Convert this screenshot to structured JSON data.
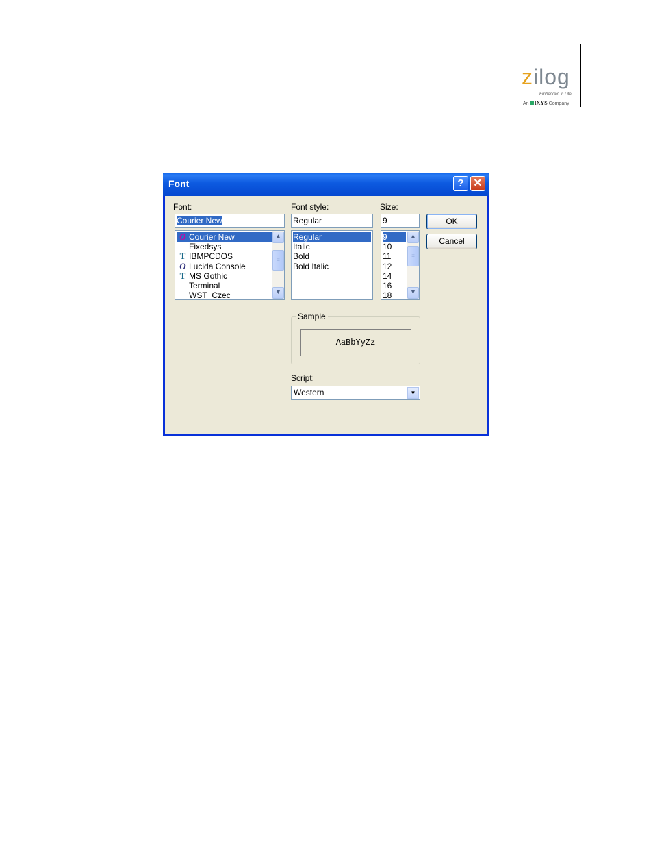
{
  "logo": {
    "wordmark_z": "z",
    "wordmark_rest": "ilog",
    "tagline": "Embedded in Life",
    "company_prefix": "An",
    "company_name": "IXYS",
    "company_suffix": "Company"
  },
  "dialog": {
    "title": "Font",
    "help_button": "?",
    "close_button": "✕",
    "font": {
      "label": "Font:",
      "value": "Courier New",
      "items": [
        {
          "icon": "O",
          "type": "opentype",
          "label": "Courier New",
          "selected": true
        },
        {
          "icon": "",
          "type": "none",
          "label": "Fixedsys"
        },
        {
          "icon": "T",
          "type": "truetype",
          "label": "IBMPCDOS"
        },
        {
          "icon": "O",
          "type": "opentype",
          "label": "Lucida Console"
        },
        {
          "icon": "T",
          "type": "truetype",
          "label": "MS Gothic"
        },
        {
          "icon": "",
          "type": "none",
          "label": "Terminal"
        },
        {
          "icon": "",
          "type": "none",
          "label": "WST_Czec"
        }
      ]
    },
    "style": {
      "label": "Font style:",
      "value": "Regular",
      "items": [
        "Regular",
        "Italic",
        "Bold",
        "Bold Italic"
      ]
    },
    "size": {
      "label": "Size:",
      "value": "9",
      "items": [
        "9",
        "10",
        "11",
        "12",
        "14",
        "16",
        "18"
      ]
    },
    "ok_label": "OK",
    "cancel_label": "Cancel",
    "sample": {
      "label": "Sample",
      "text": "AaBbYyZz"
    },
    "script": {
      "label": "Script:",
      "value": "Western"
    },
    "colors": {
      "title_bar": "#0a5fe8",
      "selection": "#316ac5",
      "dialog_bg": "#ece9d8"
    }
  }
}
